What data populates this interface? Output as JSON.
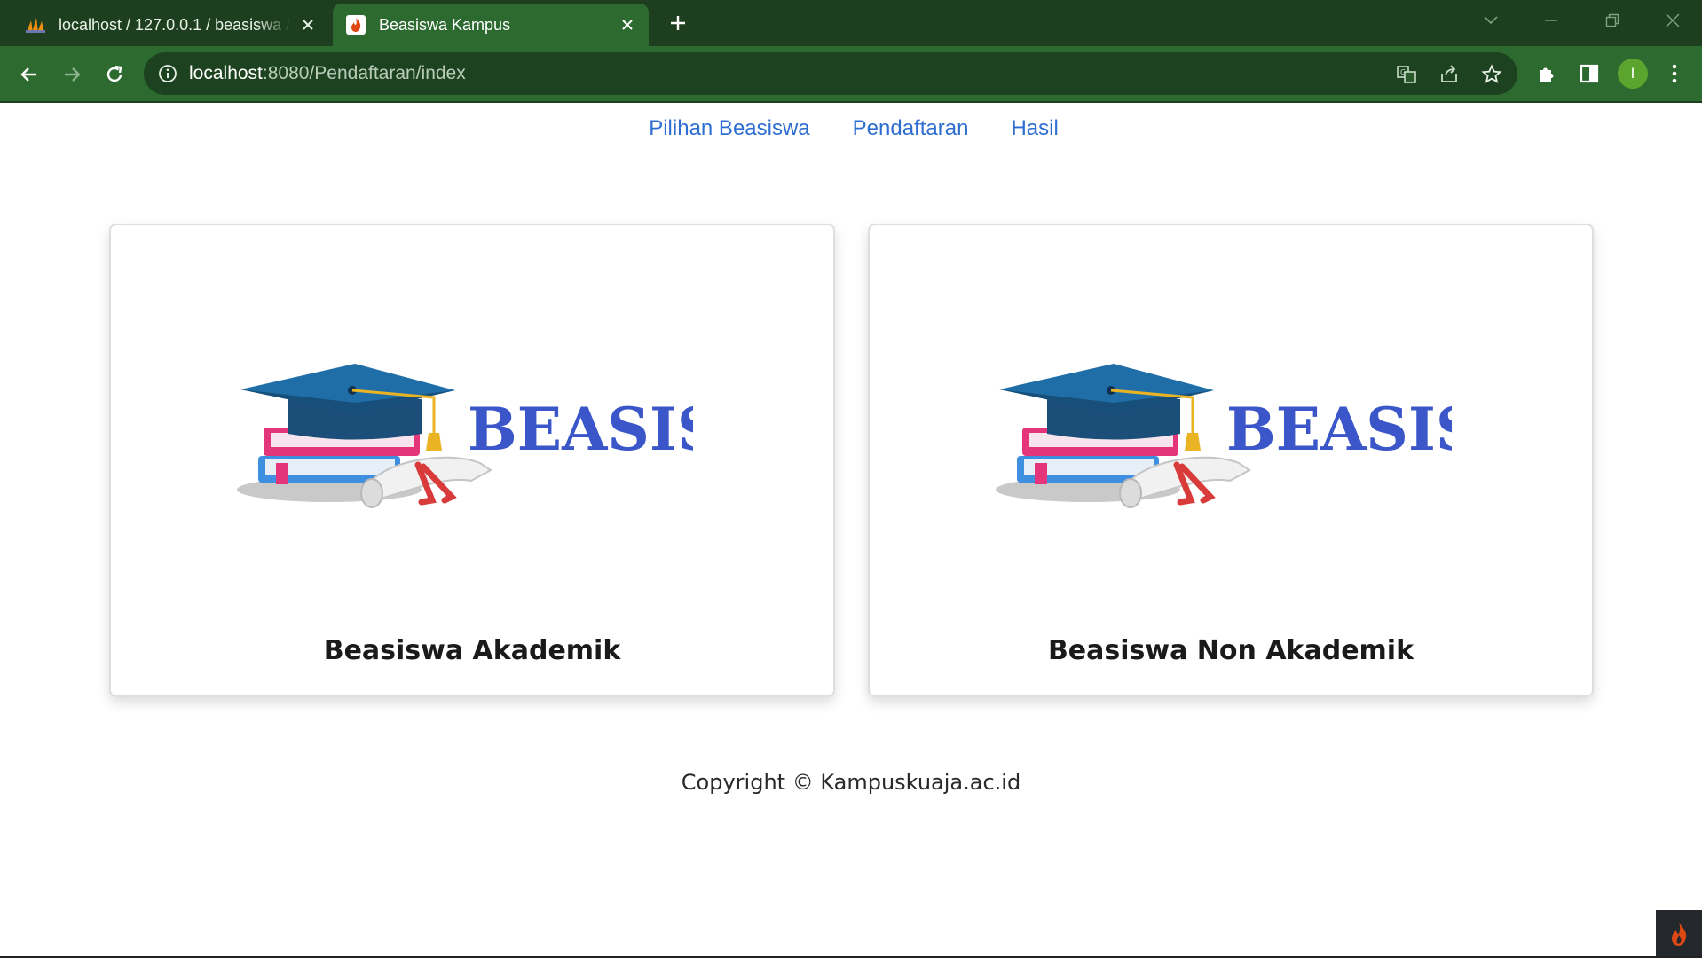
{
  "browser": {
    "tabs": [
      {
        "title": "localhost / 127.0.0.1 / beasiswa / …",
        "favicon": "phpmyadmin-icon",
        "active": false
      },
      {
        "title": "Beasiswa Kampus",
        "favicon": "codeigniter-flame-icon",
        "active": true
      }
    ],
    "address_bar": {
      "host": "localhost",
      "path": ":8080/Pendaftaran/index"
    },
    "avatar_initial": "I",
    "colors": {
      "tabstrip": "#1e3f1f",
      "toolbar": "#2d6a2f",
      "omnibox": "#1d4220",
      "avatar": "#5ba52f"
    }
  },
  "nav": {
    "items": [
      {
        "label": "Pilihan Beasiswa"
      },
      {
        "label": "Pendaftaran"
      },
      {
        "label": "Hasil"
      }
    ],
    "link_color": "#2f6ed1"
  },
  "cards": [
    {
      "title": "Beasiswa Akademik",
      "logo_text": "BEASISWA"
    },
    {
      "title": "Beasiswa Non Akademik",
      "logo_text": "BEASISWA"
    }
  ],
  "footer": {
    "text": "Copyright © Kampuskuaja.ac.id"
  },
  "colors": {
    "logo_text": "#3a56c8",
    "cap": "#1f5e8c",
    "book_pink": "#e4347a",
    "book_blue": "#3f8fe0",
    "ribbon": "#d93a3a"
  }
}
